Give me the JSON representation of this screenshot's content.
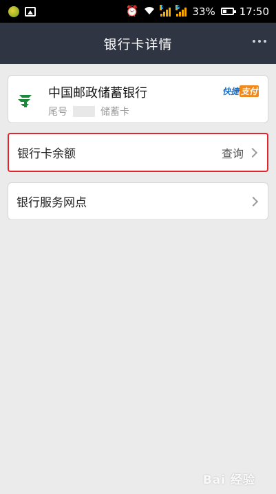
{
  "status_bar": {
    "battery_percent": "33%",
    "time": "17:50",
    "network_1": "E",
    "network_2": "G",
    "icons": [
      "app-icon",
      "gallery-icon",
      "alarm-icon",
      "wifi-icon",
      "signal-icon",
      "signal-icon",
      "battery-icon"
    ]
  },
  "header": {
    "title": "银行卡详情",
    "menu_icon": "more-icon"
  },
  "bank_card": {
    "bank_name": "中国邮政储蓄银行",
    "tail_label": "尾号",
    "card_type": "储蓄卡",
    "badge_left": "快捷",
    "badge_right": "支付",
    "logo_color": "#1a8a3a"
  },
  "rows": {
    "balance": {
      "label": "银行卡余额",
      "action": "查询"
    },
    "branches": {
      "label": "银行服务网点"
    }
  },
  "watermark": {
    "text": "Bai 经验"
  },
  "colors": {
    "header_bg": "#2f3543",
    "page_bg": "#ebebeb",
    "highlight_border": "#e0262b"
  }
}
